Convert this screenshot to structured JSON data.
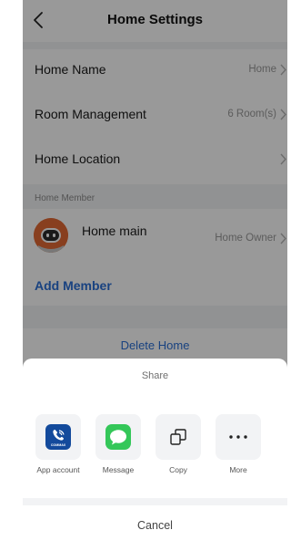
{
  "header": {
    "title": "Home Settings"
  },
  "settings": [
    {
      "label": "Home Name",
      "value": "Home"
    },
    {
      "label": "Room Management",
      "value": "6 Room(s)"
    },
    {
      "label": "Home Location",
      "value": ""
    }
  ],
  "members": {
    "section_label": "Home Member",
    "items": [
      {
        "name": "Home main",
        "role": "Home Owner"
      }
    ],
    "add_label": "Add Member"
  },
  "delete_label": "Delete Home",
  "share_sheet": {
    "title": "Share",
    "options": [
      {
        "label": "App account",
        "icon": "commax-app-icon",
        "icon_text": "COMMAX",
        "color": "#134a9c"
      },
      {
        "label": "Message",
        "icon": "message-icon",
        "color": "#34c759"
      },
      {
        "label": "Copy",
        "icon": "copy-icon"
      },
      {
        "label": "More",
        "icon": "more-icon"
      }
    ],
    "cancel_label": "Cancel"
  },
  "colors": {
    "accent": "#2a6fd6",
    "background": "#f2f3f5",
    "overlay": "rgba(0,0,0,0.4)"
  }
}
